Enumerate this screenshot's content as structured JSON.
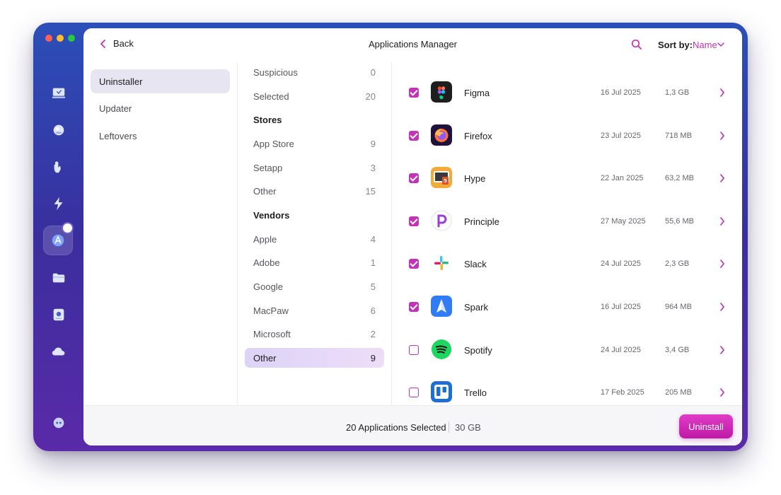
{
  "header": {
    "back_label": "Back",
    "title": "Applications Manager",
    "sort_label": "Sort by:",
    "sort_value": "Name"
  },
  "nav": {
    "items": [
      {
        "label": "Uninstaller",
        "active": true
      },
      {
        "label": "Updater",
        "active": false
      },
      {
        "label": "Leftovers",
        "active": false
      }
    ]
  },
  "categories": {
    "items": [
      {
        "label": "Suspicious",
        "count": "0"
      },
      {
        "label": "Selected",
        "count": "20"
      },
      {
        "label": "Stores",
        "count": ""
      },
      {
        "label": "App Store",
        "count": "9"
      },
      {
        "label": "Setapp",
        "count": "3"
      },
      {
        "label": "Other",
        "count": "15"
      },
      {
        "label": "Vendors",
        "count": ""
      },
      {
        "label": "Apple",
        "count": "4"
      },
      {
        "label": "Adobe",
        "count": "1"
      },
      {
        "label": "Google",
        "count": "5"
      },
      {
        "label": "MacPaw",
        "count": "6"
      },
      {
        "label": "Microsoft",
        "count": "2"
      },
      {
        "label": "Other",
        "count": "9"
      }
    ]
  },
  "apps": {
    "items": [
      {
        "name": "Figma",
        "date": "16 Jul 2025",
        "size": "1,3 GB",
        "checked": true,
        "icon": "figma-icon"
      },
      {
        "name": "Firefox",
        "date": "23 Jul 2025",
        "size": "718 MB",
        "checked": true,
        "icon": "firefox-icon"
      },
      {
        "name": "Hype",
        "date": "22 Jan 2025",
        "size": "63,2 MB",
        "checked": true,
        "icon": "hype-icon"
      },
      {
        "name": "Principle",
        "date": "27 May 2025",
        "size": "55,6 MB",
        "checked": true,
        "icon": "principle-icon"
      },
      {
        "name": "Slack",
        "date": "24 Jul 2025",
        "size": "2,3 GB",
        "checked": true,
        "icon": "slack-icon"
      },
      {
        "name": "Spark",
        "date": "16 Jul 2025",
        "size": "964 MB",
        "checked": true,
        "icon": "spark-icon"
      },
      {
        "name": "Spotify",
        "date": "24 Jul 2025",
        "size": "3,4 GB",
        "checked": false,
        "icon": "spotify-icon"
      },
      {
        "name": "Trello",
        "date": "17 Feb 2025",
        "size": "205 MB",
        "checked": false,
        "icon": "trello-icon"
      }
    ]
  },
  "footer": {
    "selected_text": "20 Applications Selected",
    "selected_size": "30 GB",
    "uninstall_label": "Uninstall"
  },
  "colors": {
    "accent": "#c233b6",
    "rail_gradient_top": "#2b4fb8",
    "rail_gradient_bottom": "#5a2aa8"
  }
}
